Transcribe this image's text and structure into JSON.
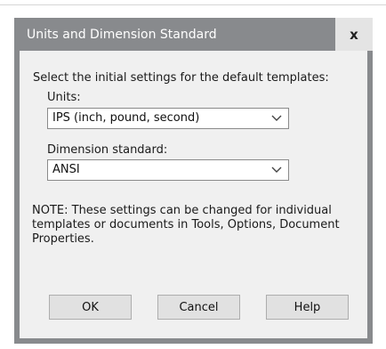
{
  "dialog": {
    "title": "Units and Dimension Standard",
    "close_label": "x",
    "prompt": "Select the initial settings for the default templates:",
    "units": {
      "label": "Units:",
      "selected": "IPS (inch, pound, second)"
    },
    "dimension_standard": {
      "label": "Dimension standard:",
      "selected": "ANSI"
    },
    "note": "NOTE: These settings can be changed for individual templates or documents in Tools, Options, Document Properties.",
    "buttons": {
      "ok": "OK",
      "cancel": "Cancel",
      "help": "Help"
    }
  },
  "icons": {
    "dropdown": "chevron-down-icon",
    "close": "close-icon"
  },
  "colors": {
    "title_bar": "#888a8d",
    "client_background": "#f0f0f0",
    "button_face": "#e1e1e1"
  }
}
